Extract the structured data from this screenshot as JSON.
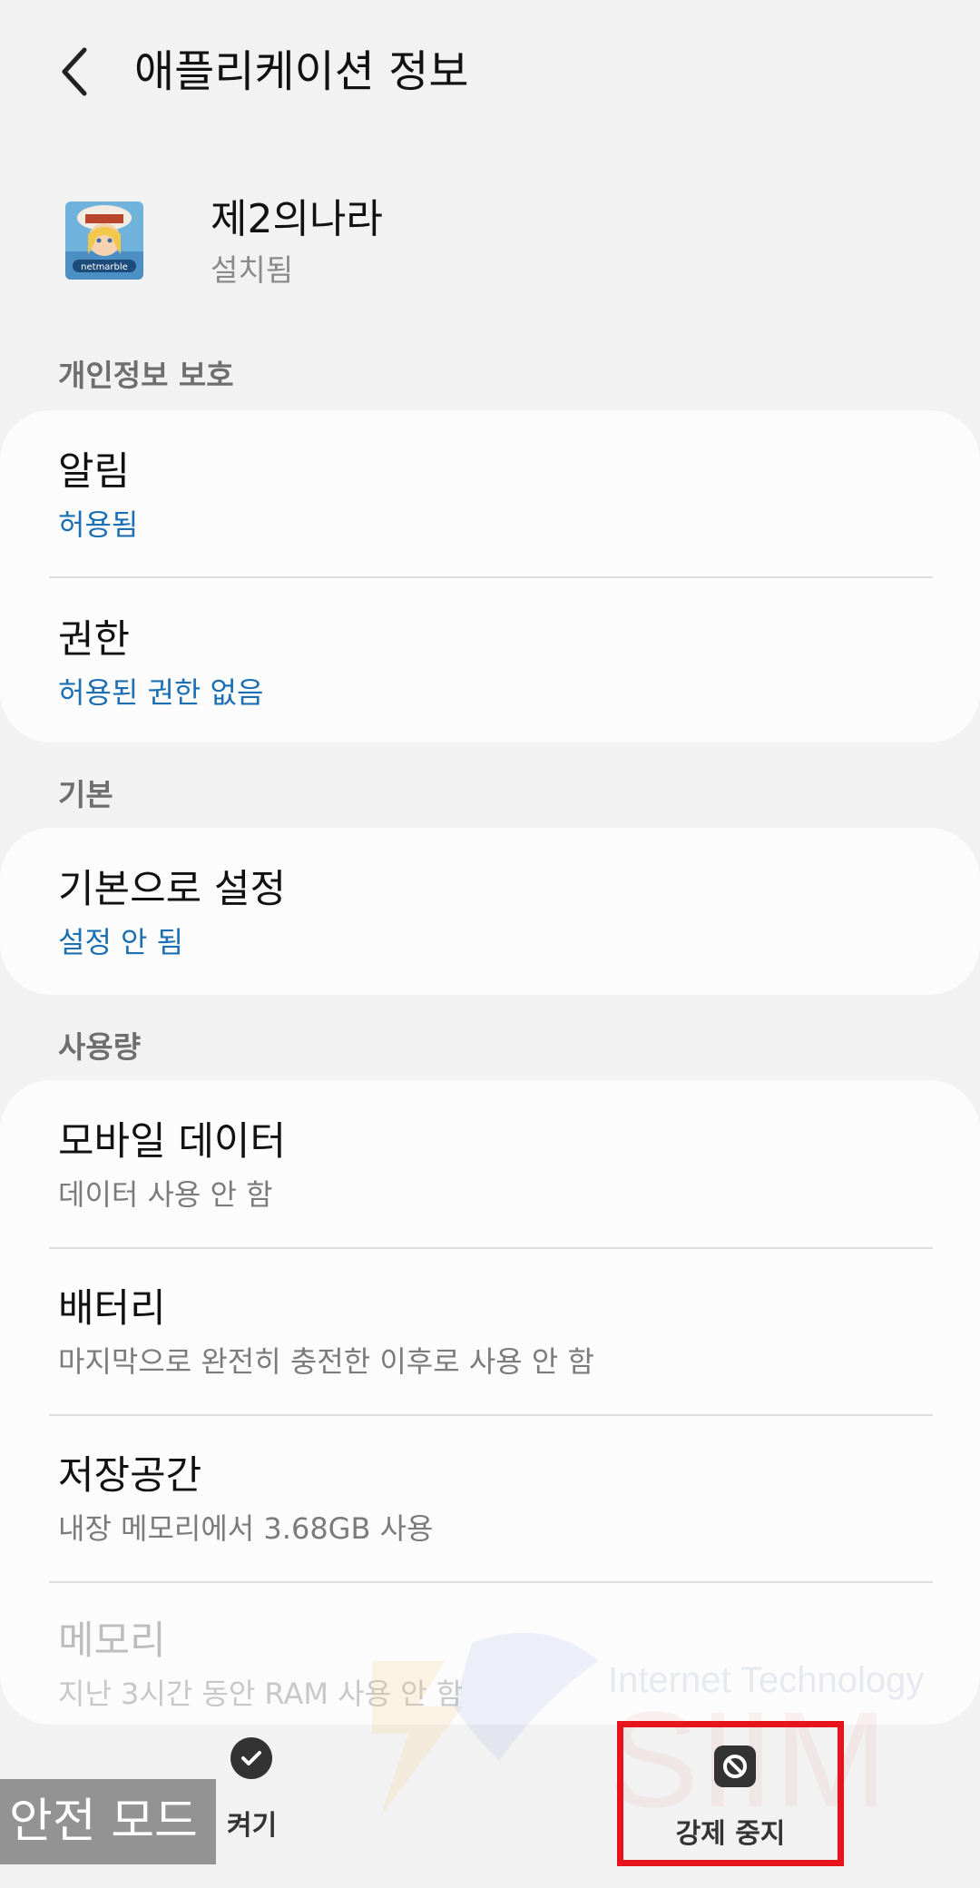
{
  "header": {
    "title": "애플리케이션 정보"
  },
  "app": {
    "name": "제2의나라",
    "status": "설치됨",
    "icon_text": "netmarble"
  },
  "privacy": {
    "section": "개인정보 보호",
    "items": [
      {
        "title": "알림",
        "sub": "허용됨"
      },
      {
        "title": "권한",
        "sub": "허용된 권한 없음"
      }
    ]
  },
  "defaults": {
    "section": "기본",
    "items": [
      {
        "title": "기본으로 설정",
        "sub": "설정 안 됨"
      }
    ]
  },
  "usage": {
    "section": "사용량",
    "items": [
      {
        "title": "모바일 데이터",
        "sub": "데이터 사용 안 함"
      },
      {
        "title": "배터리",
        "sub": "마지막으로 완전히 충전한 이후로 사용 안 함"
      },
      {
        "title": "저장공간",
        "sub": "내장 메모리에서 3.68GB 사용"
      },
      {
        "title": "메모리",
        "sub": "지난 3시간 동안 RAM 사용 안 함"
      }
    ]
  },
  "watermark": {
    "text": "Internet Technology",
    "logo": "SIIM"
  },
  "bottom": {
    "enable_label": "켜기",
    "force_stop_label": "강제 중지",
    "safe_mode": "안전 모드"
  },
  "colors": {
    "accent_blue": "#1c6fb3",
    "highlight_red": "#e8141c",
    "background": "#f2f2f2",
    "card": "#fcfcfc"
  }
}
